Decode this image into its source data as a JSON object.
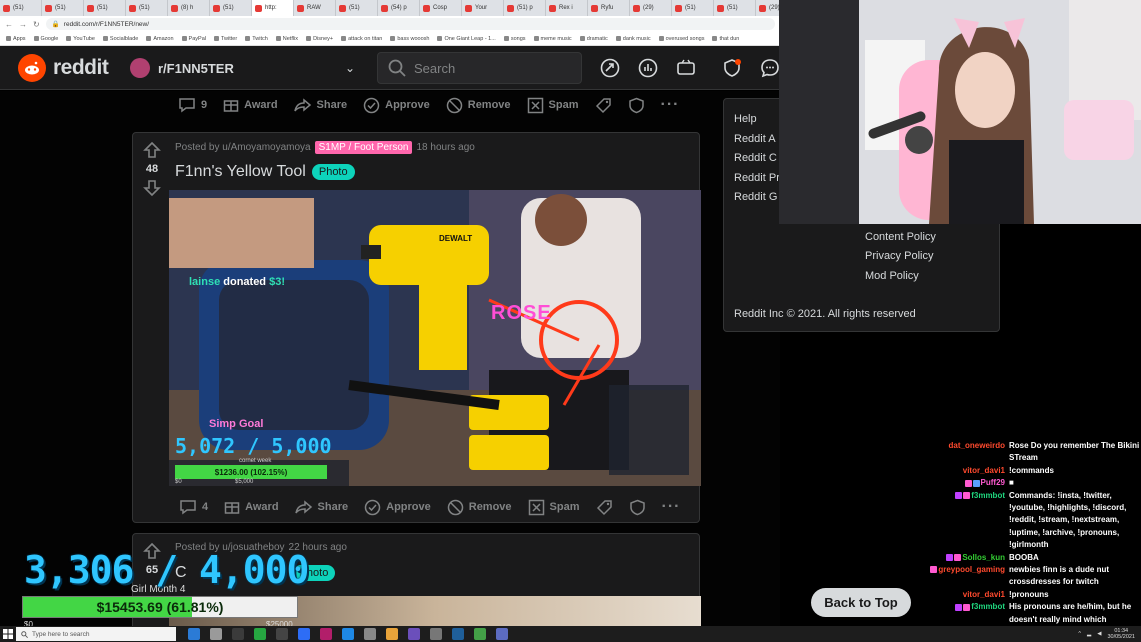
{
  "browser": {
    "tabs": [
      "(51)",
      "(51)",
      "(51)",
      "(51)",
      "(8) h",
      "(51)",
      "http:",
      "RAW",
      "(51)",
      "(54) p",
      "Cosp",
      "Your",
      "(51) p",
      "Rex i",
      "Ryfu",
      "(29)",
      "(51)",
      "(51)",
      "(29)",
      "(29)"
    ],
    "url": "reddit.com/r/F1NN5TER/new/",
    "bookmarks": [
      "Apps",
      "Google",
      "YouTube",
      "Socialblade",
      "Amazon",
      "PayPal",
      "Twitter",
      "Twitch",
      "Netflix",
      "Disney+",
      "attack on titan",
      "bass wooosh",
      "One Giant Leap - 1...",
      "songs",
      "meme music",
      "dramatic",
      "dank music",
      "overused songs",
      "that dun"
    ]
  },
  "header": {
    "logo_text": "reddit",
    "community": "r/F1NN5TER",
    "search_placeholder": "Search"
  },
  "post1_actions": {
    "comments": "9",
    "award": "Award",
    "share": "Share",
    "approve": "Approve",
    "remove": "Remove",
    "spam": "Spam"
  },
  "post2": {
    "score": "48",
    "posted_by": "Posted by u/Amoyamoyamoya",
    "user_flair": "S1MP / Foot Person",
    "time": "18 hours ago",
    "title": "F1nn's Yellow Tool",
    "flair": "Photo",
    "image": {
      "donation_name": "lainse",
      "donation_text": "donated",
      "donation_amount": "$3!",
      "drill_brand": "DEWALT",
      "neon": "ROSE",
      "goal_label": "Simp Goal",
      "goal_value": "5,072 / 5,000",
      "goal_sub": "cornet week",
      "goal_bar": "$1236.00 (102.15%)",
      "goal_bar_pct": 100,
      "goal_min": "$0",
      "goal_max": "$5,000"
    },
    "actions": {
      "comments": "4",
      "award": "Award",
      "share": "Share",
      "approve": "Approve",
      "remove": "Remove",
      "spam": "Spam"
    }
  },
  "post3": {
    "score": "65",
    "posted_by": "Posted by u/josuatheboy",
    "time": "22 hours ago",
    "title": "C",
    "flair": "Photo"
  },
  "sidebar": {
    "items": [
      "Help",
      "Reddit A",
      "Reddit C",
      "Reddit Pr",
      "Reddit G",
      "Content Policy",
      "Privacy Policy",
      "Mod Policy"
    ],
    "copyright": "Reddit Inc © 2021. All rights reserved"
  },
  "chat": [
    {
      "user": "dat_oneweirdo",
      "color": "#ff4a2e",
      "badges": [],
      "msg": "Rose Do you remember The Bikini STream"
    },
    {
      "user": "vitor_davi1",
      "color": "#ff4a2e",
      "badges": [],
      "msg": "!commands"
    },
    {
      "user": "Puff29",
      "color": "#ff5ad0",
      "badges": [
        "#ff5ad0",
        "#5aa0ff"
      ],
      "msg": "■"
    },
    {
      "user": "f3mmbot",
      "color": "#1fd67e",
      "badges": [
        "#c040ff",
        "#ff5ad0"
      ],
      "msg": "Commands: !insta, !twitter, !youtube, !highlights, !discord, !reddit, !stream, !nextstream, !uptime, !archive, !pronouns, !girlmonth"
    },
    {
      "user": "Sollos_kun",
      "color": "#33cc33",
      "badges": [
        "#c040ff",
        "#ff5ad0"
      ],
      "msg": "BOOBA"
    },
    {
      "user": "greypool_gaming",
      "color": "#ff4a2e",
      "badges": [
        "#ff5ad0"
      ],
      "msg": "newbies finn is a dude nut crossdresses for twitch"
    },
    {
      "user": "vitor_davi1",
      "color": "#ff4a2e",
      "badges": [],
      "msg": "!pronouns"
    },
    {
      "user": "f3mmbot",
      "color": "#1fd67e",
      "badges": [
        "#c040ff",
        "#ff5ad0"
      ],
      "msg": "His pronouns are he/him, but he doesn't really mind which pronouns you use"
    }
  ],
  "back_to_top": "Back to Top",
  "overlay_goal": {
    "value": "3,306 / 4,000",
    "sub": "Girl Month 4",
    "bar_text": "$15453.69 (61.81%)",
    "bar_pct": 61.81,
    "min": "$0",
    "max": "$25000"
  },
  "taskbar": {
    "search_placeholder": "Type here to search",
    "time": "01:34",
    "date": "30/05/2021",
    "app_colors": [
      "#2b7bd6",
      "#9a9a9a",
      "#3b3b3b",
      "#26a641",
      "#444",
      "#2d6df6",
      "#b21e6a",
      "#1e88e5",
      "#888",
      "#e8a33a",
      "#6b4fbb",
      "#777",
      "#1f5f9a",
      "#43a047",
      "#5c6bc0"
    ]
  }
}
